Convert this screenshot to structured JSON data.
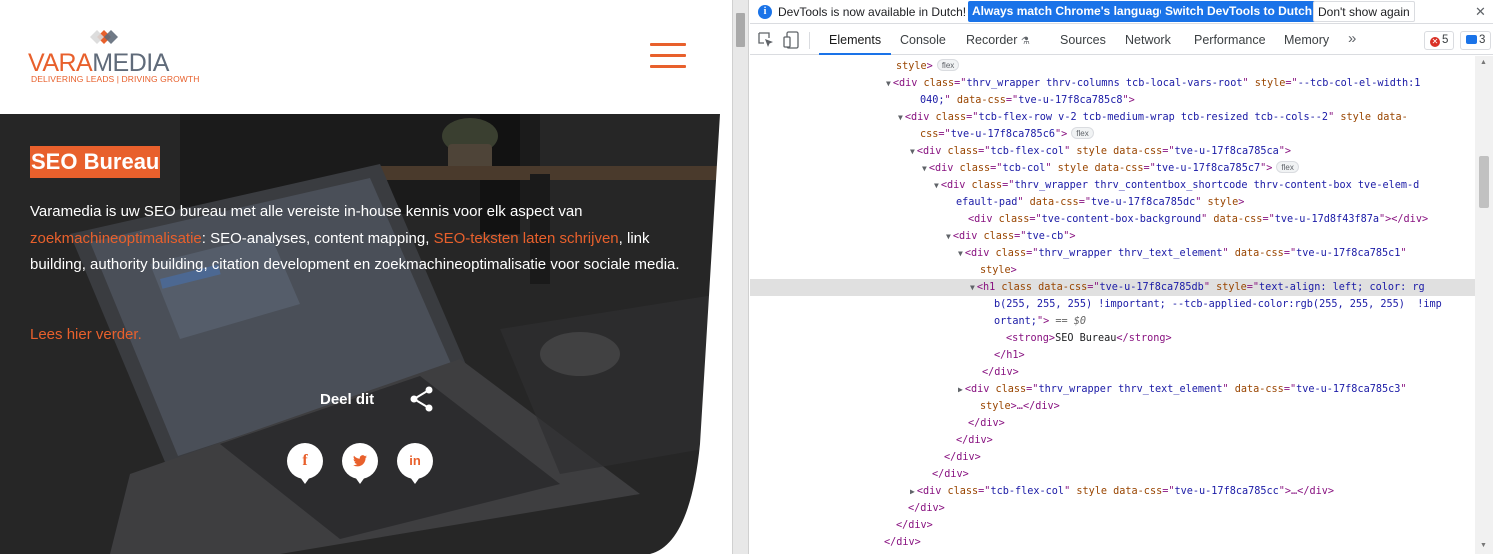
{
  "site": {
    "logo": {
      "word_a": "VARA",
      "word_b": "MEDIA",
      "tagline": "DELIVERING LEADS | DRIVING GROWTH"
    },
    "hero": {
      "title": "SEO Bureau",
      "para_1": "Varamedia is uw SEO bureau met alle vereiste in-house kennis voor elk aspect van ",
      "link_1": "zoekmachineoptimalisatie",
      "para_2": ": SEO-analyses, content mapping, ",
      "link_2": "SEO-teksten laten schrijven",
      "para_3": ", link building, authority building, citation development en zoekmachineoptimalisatie voor sociale media.",
      "read_more": "Lees hier verder.",
      "share_label": "Deel dit",
      "social": {
        "facebook": "f",
        "twitter": "t",
        "linkedin": "in"
      }
    },
    "colors": {
      "accent": "#e8602c",
      "hero_overlay": "#2b2b2b"
    }
  },
  "devtools": {
    "infobar": {
      "message": "DevTools is now available in Dutch!",
      "btn_match": "Always match Chrome's language",
      "btn_switch": "Switch DevTools to Dutch",
      "btn_dont": "Don't show again",
      "close": "✕"
    },
    "tabs": [
      "Elements",
      "Console",
      "Recorder",
      "Sources",
      "Network",
      "Performance",
      "Memory"
    ],
    "more": "»",
    "errors": "5",
    "messages": "3",
    "dom_lines": [
      [
        {
          "t": "an",
          "v": "style"
        },
        {
          "t": "tg",
          "v": ">"
        },
        {
          "t": "pill",
          "v": "flex"
        }
      ],
      [
        {
          "t": "tg",
          "v": "<div "
        },
        {
          "t": "an",
          "v": "class"
        },
        {
          "t": "tg",
          "v": "=\""
        },
        {
          "t": "av",
          "v": "thrv_wrapper thrv-columns tcb-local-vars-root"
        },
        {
          "t": "tg",
          "v": "\" "
        },
        {
          "t": "an",
          "v": "style"
        },
        {
          "t": "tg",
          "v": "=\""
        },
        {
          "t": "av",
          "v": "--tcb-col-el-width:1"
        }
      ],
      [
        {
          "t": "av",
          "v": "040;"
        },
        {
          "t": "tg",
          "v": "\" "
        },
        {
          "t": "an",
          "v": "data-css"
        },
        {
          "t": "tg",
          "v": "=\""
        },
        {
          "t": "av",
          "v": "tve-u-17f8ca785c8"
        },
        {
          "t": "tg",
          "v": "\">"
        }
      ],
      [
        {
          "t": "tg",
          "v": "<div "
        },
        {
          "t": "an",
          "v": "class"
        },
        {
          "t": "tg",
          "v": "=\""
        },
        {
          "t": "av",
          "v": "tcb-flex-row v-2 tcb-medium-wrap tcb-resized tcb--cols--2"
        },
        {
          "t": "tg",
          "v": "\" "
        },
        {
          "t": "an",
          "v": "style data-"
        }
      ],
      [
        {
          "t": "an",
          "v": "css"
        },
        {
          "t": "tg",
          "v": "=\""
        },
        {
          "t": "av",
          "v": "tve-u-17f8ca785c6"
        },
        {
          "t": "tg",
          "v": "\">"
        },
        {
          "t": "pill",
          "v": "flex"
        }
      ],
      [
        {
          "t": "tg",
          "v": "<div "
        },
        {
          "t": "an",
          "v": "class"
        },
        {
          "t": "tg",
          "v": "=\""
        },
        {
          "t": "av",
          "v": "tcb-flex-col"
        },
        {
          "t": "tg",
          "v": "\" "
        },
        {
          "t": "an",
          "v": "style data-css"
        },
        {
          "t": "tg",
          "v": "=\""
        },
        {
          "t": "av",
          "v": "tve-u-17f8ca785ca"
        },
        {
          "t": "tg",
          "v": "\">"
        }
      ],
      [
        {
          "t": "tg",
          "v": "<div "
        },
        {
          "t": "an",
          "v": "class"
        },
        {
          "t": "tg",
          "v": "=\""
        },
        {
          "t": "av",
          "v": "tcb-col"
        },
        {
          "t": "tg",
          "v": "\" "
        },
        {
          "t": "an",
          "v": "style data-css"
        },
        {
          "t": "tg",
          "v": "=\""
        },
        {
          "t": "av",
          "v": "tve-u-17f8ca785c7"
        },
        {
          "t": "tg",
          "v": "\">"
        },
        {
          "t": "pill",
          "v": "flex"
        }
      ],
      [
        {
          "t": "tg",
          "v": "<div "
        },
        {
          "t": "an",
          "v": "class"
        },
        {
          "t": "tg",
          "v": "=\""
        },
        {
          "t": "av",
          "v": "thrv_wrapper thrv_contentbox_shortcode thrv-content-box tve-elem-d"
        }
      ],
      [
        {
          "t": "av",
          "v": "efault-pad"
        },
        {
          "t": "tg",
          "v": "\" "
        },
        {
          "t": "an",
          "v": "data-css"
        },
        {
          "t": "tg",
          "v": "=\""
        },
        {
          "t": "av",
          "v": "tve-u-17f8ca785dc"
        },
        {
          "t": "tg",
          "v": "\" "
        },
        {
          "t": "an",
          "v": "style"
        },
        {
          "t": "tg",
          "v": ">"
        }
      ],
      [
        {
          "t": "tg",
          "v": "<div "
        },
        {
          "t": "an",
          "v": "class"
        },
        {
          "t": "tg",
          "v": "=\""
        },
        {
          "t": "av",
          "v": "tve-content-box-background"
        },
        {
          "t": "tg",
          "v": "\" "
        },
        {
          "t": "an",
          "v": "data-css"
        },
        {
          "t": "tg",
          "v": "=\""
        },
        {
          "t": "av",
          "v": "tve-u-17d8f43f87a"
        },
        {
          "t": "tg",
          "v": "\"></div>"
        }
      ],
      [
        {
          "t": "tg",
          "v": "<div "
        },
        {
          "t": "an",
          "v": "class"
        },
        {
          "t": "tg",
          "v": "=\""
        },
        {
          "t": "av",
          "v": "tve-cb"
        },
        {
          "t": "tg",
          "v": "\">"
        }
      ],
      [
        {
          "t": "tg",
          "v": "<div "
        },
        {
          "t": "an",
          "v": "class"
        },
        {
          "t": "tg",
          "v": "=\""
        },
        {
          "t": "av",
          "v": "thrv_wrapper thrv_text_element"
        },
        {
          "t": "tg",
          "v": "\" "
        },
        {
          "t": "an",
          "v": "data-css"
        },
        {
          "t": "tg",
          "v": "=\""
        },
        {
          "t": "av",
          "v": "tve-u-17f8ca785c1"
        },
        {
          "t": "tg",
          "v": "\""
        }
      ],
      [
        {
          "t": "an",
          "v": "style"
        },
        {
          "t": "tg",
          "v": ">"
        }
      ],
      [
        {
          "t": "tg",
          "v": "<h1 "
        },
        {
          "t": "an",
          "v": "class data-css"
        },
        {
          "t": "tg",
          "v": "=\""
        },
        {
          "t": "av",
          "v": "tve-u-17f8ca785db"
        },
        {
          "t": "tg",
          "v": "\" "
        },
        {
          "t": "an",
          "v": "style"
        },
        {
          "t": "tg",
          "v": "=\""
        },
        {
          "t": "av",
          "v": "text-align: left; color: rg"
        }
      ],
      [
        {
          "t": "av",
          "v": "b(255, 255, 255) !important; --tcb-applied-color:rgb(255, 255, 255)  !imp"
        }
      ],
      [
        {
          "t": "av",
          "v": "ortant;"
        },
        {
          "t": "tg",
          "v": "\">"
        },
        {
          "t": "dim",
          "v": " == $0"
        }
      ],
      [
        {
          "t": "tg",
          "v": "<strong>"
        },
        {
          "t": "tx",
          "v": "SEO Bureau"
        },
        {
          "t": "tg",
          "v": "</strong>"
        }
      ],
      [
        {
          "t": "tg",
          "v": "</h1>"
        }
      ],
      [
        {
          "t": "tg",
          "v": "</div>"
        }
      ],
      [
        {
          "t": "tg",
          "v": "<div "
        },
        {
          "t": "an",
          "v": "class"
        },
        {
          "t": "tg",
          "v": "=\""
        },
        {
          "t": "av",
          "v": "thrv_wrapper thrv_text_element"
        },
        {
          "t": "tg",
          "v": "\" "
        },
        {
          "t": "an",
          "v": "data-css"
        },
        {
          "t": "tg",
          "v": "=\""
        },
        {
          "t": "av",
          "v": "tve-u-17f8ca785c3"
        },
        {
          "t": "tg",
          "v": "\""
        }
      ],
      [
        {
          "t": "an",
          "v": "style"
        },
        {
          "t": "tg",
          "v": ">…</div>"
        }
      ],
      [
        {
          "t": "tg",
          "v": "</div>"
        }
      ],
      [
        {
          "t": "tg",
          "v": "</div>"
        }
      ],
      [
        {
          "t": "tg",
          "v": "</div>"
        }
      ],
      [
        {
          "t": "tg",
          "v": "</div>"
        }
      ],
      [
        {
          "t": "tg",
          "v": "<div "
        },
        {
          "t": "an",
          "v": "class"
        },
        {
          "t": "tg",
          "v": "=\""
        },
        {
          "t": "av",
          "v": "tcb-flex-col"
        },
        {
          "t": "tg",
          "v": "\" "
        },
        {
          "t": "an",
          "v": "style data-css"
        },
        {
          "t": "tg",
          "v": "=\""
        },
        {
          "t": "av",
          "v": "tve-u-17f8ca785cc"
        },
        {
          "t": "tg",
          "v": "\">…</div>"
        }
      ],
      [
        {
          "t": "tg",
          "v": "</div>"
        }
      ],
      [
        {
          "t": "tg",
          "v": "</div>"
        }
      ],
      [
        {
          "t": "tg",
          "v": "</div>"
        }
      ]
    ],
    "line_meta": {
      "arrows": [
        "",
        "open",
        "",
        "open",
        "",
        "open",
        "open",
        "open",
        "",
        "",
        "open",
        "open",
        "",
        "open",
        "",
        "",
        "",
        "",
        "",
        "closed",
        "",
        "",
        "",
        "",
        "",
        "closed",
        "",
        "",
        ""
      ],
      "selected_index": 13
    },
    "gutter_ellipsis": "•••"
  }
}
